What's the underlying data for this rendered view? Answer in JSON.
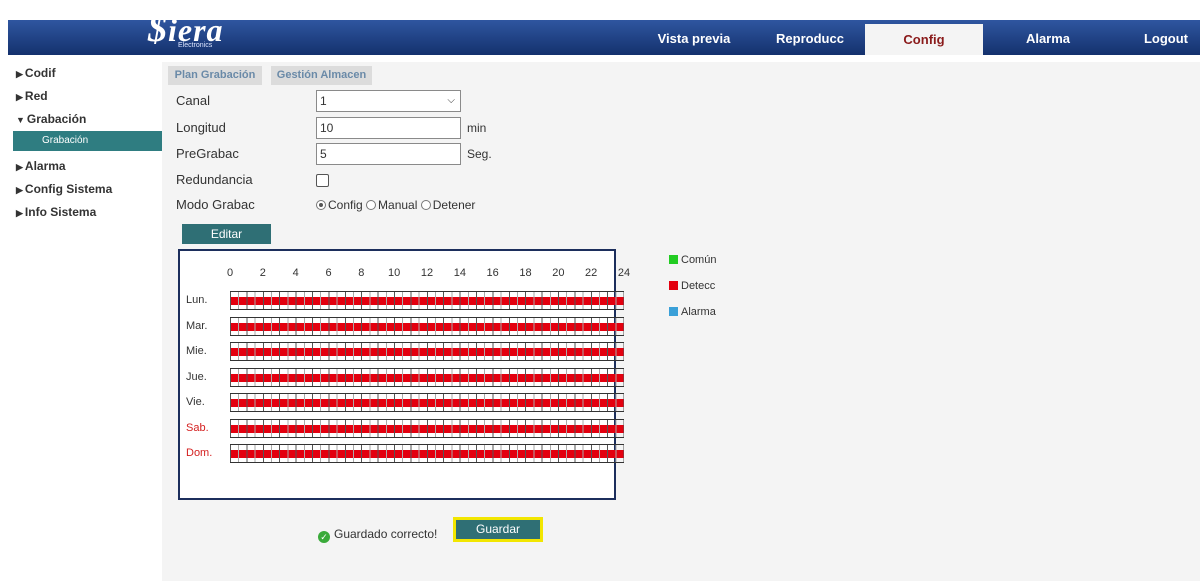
{
  "header": {
    "brand": "iera",
    "brand_sub": "Electronics",
    "nav": [
      {
        "label": "Vista previa"
      },
      {
        "label": "Reproducc"
      },
      {
        "label": "Config",
        "active": true
      },
      {
        "label": "Alarma"
      },
      {
        "label": "Logout"
      }
    ]
  },
  "sidebar": {
    "items": [
      {
        "label": "Codif",
        "arrow": "▶"
      },
      {
        "label": "Red",
        "arrow": "▶"
      },
      {
        "label": "Grabación",
        "arrow": "▼"
      },
      {
        "label": "Alarma",
        "arrow": "▶"
      },
      {
        "label": "Config Sistema",
        "arrow": "▶"
      },
      {
        "label": "Info Sistema",
        "arrow": "▶"
      }
    ],
    "sub_item": "Grabación"
  },
  "tabs": [
    "Plan Grabación",
    "Gestión Almacen"
  ],
  "form": {
    "canal_label": "Canal",
    "canal_value": "1",
    "longitud_label": "Longitud",
    "longitud_value": "10",
    "longitud_unit": "min",
    "pregrabac_label": "PreGrabac",
    "pregrabac_value": "5",
    "pregrabac_unit": "Seg.",
    "redundancia_label": "Redundancia",
    "redundancia_checked": false,
    "modo_label": "Modo Grabac",
    "modo_options": [
      "Config",
      "Manual",
      "Detener"
    ],
    "modo_selected": "Config"
  },
  "edit_button": "Editar",
  "schedule": {
    "hours": [
      "0",
      "2",
      "4",
      "6",
      "8",
      "10",
      "12",
      "14",
      "16",
      "18",
      "20",
      "22",
      "24"
    ],
    "days": [
      {
        "label": "Lun.",
        "color": "#333333"
      },
      {
        "label": "Mar.",
        "color": "#333333"
      },
      {
        "label": "Mie.",
        "color": "#333333"
      },
      {
        "label": "Jue.",
        "color": "#333333"
      },
      {
        "label": "Vie.",
        "color": "#333333"
      },
      {
        "label": "Sab.",
        "color": "#d42020"
      },
      {
        "label": "Dom.",
        "color": "#d42020"
      }
    ],
    "band_color": "#e3000f"
  },
  "legend": [
    {
      "label": "Común",
      "color": "#22cc22"
    },
    {
      "label": "Detecc",
      "color": "#e3000f"
    },
    {
      "label": "Alarma",
      "color": "#3aa0d8"
    }
  ],
  "status": {
    "message": "Guardado correcto!",
    "save_button": "Guardar"
  }
}
